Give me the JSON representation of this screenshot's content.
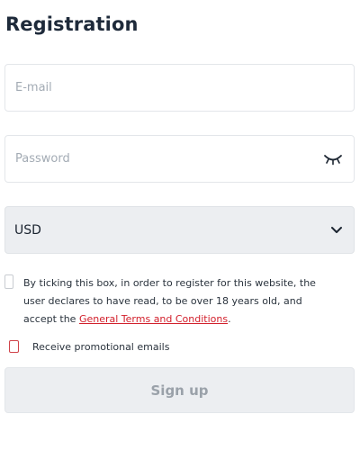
{
  "form": {
    "title": "Registration",
    "email_placeholder": "E-mail",
    "password_placeholder": "Password",
    "password_toggle_icon": "eye-closed-icon",
    "currency": {
      "selected": "USD",
      "icon": "chevron-down-icon"
    },
    "terms": {
      "text_before": "By ticking this box, in order to register for this website, the user declares to have read, to be over 18 years old, and accept the ",
      "link_text": "General Terms and Conditions",
      "text_after": ".",
      "checked": false
    },
    "promo": {
      "label": "Receive promotional emails",
      "checked": false
    },
    "signup_label": "Sign up"
  },
  "colors": {
    "link": "#d21f2b",
    "disabled_button_bg": "#eceef1",
    "disabled_button_text": "#9aa1a9"
  }
}
